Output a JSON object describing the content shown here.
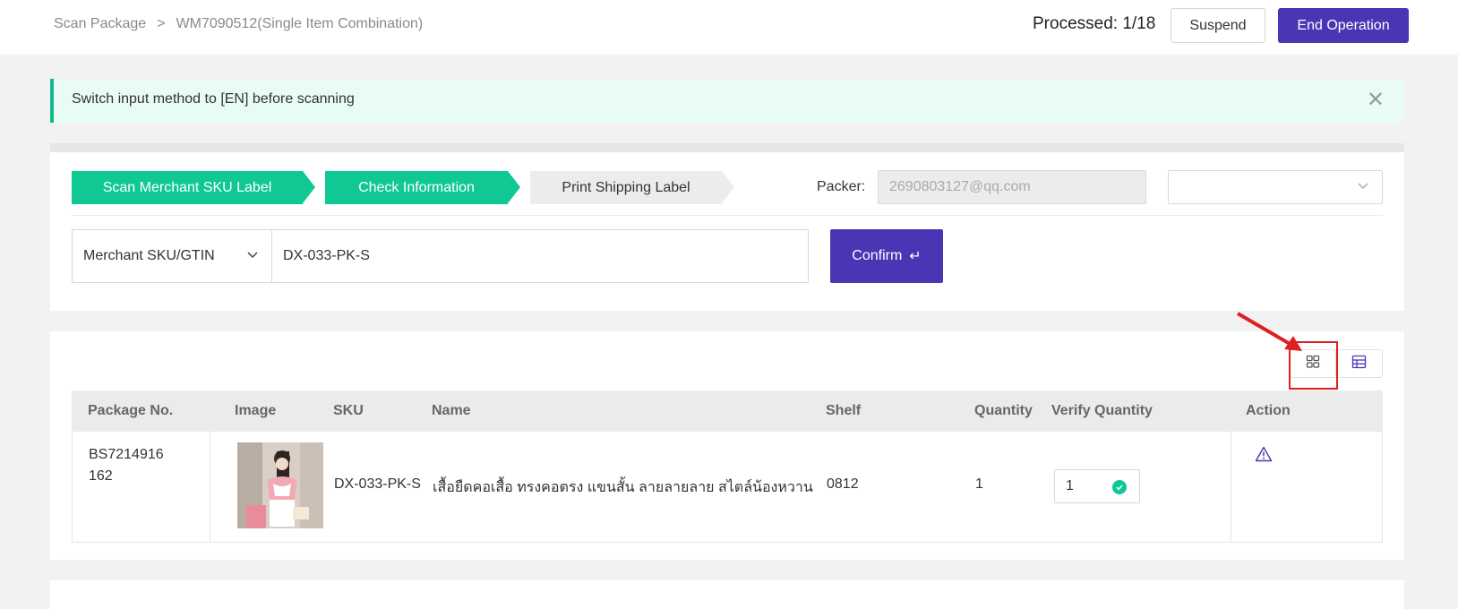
{
  "header": {
    "breadcrumb": [
      "Scan Package",
      ">",
      "WM7090512(Single Item Combination)"
    ],
    "processed": "Processed: 1/18",
    "suspend_label": "Suspend",
    "end_label": "End Operation"
  },
  "alert": {
    "text": "Switch input method to [EN] before scanning",
    "close": "✕"
  },
  "steps": [
    {
      "label": "Scan Merchant SKU Label",
      "state": "done"
    },
    {
      "label": "Check Information",
      "state": "active"
    },
    {
      "label": "Print Shipping Label",
      "state": "pending"
    }
  ],
  "packer": {
    "label": "Packer:",
    "value": "2690803127@qq.com",
    "select_value": ""
  },
  "scan": {
    "type": "Merchant SKU/GTIN",
    "value": "DX-033-PK-S",
    "confirm_label": "Confirm",
    "confirm_icon": "↵"
  },
  "table": {
    "headers": [
      "Package No.",
      "Image",
      "SKU",
      "Name",
      "Shelf",
      "Quantity",
      "Verify Quantity",
      "Action"
    ],
    "rows": [
      {
        "package_no_line1": "BS7214916",
        "package_no_line2": "162",
        "sku": "DX-033-PK-S",
        "name": "เสื้อยืดคอเสื้อ ทรงคอตรง แขนสั้น ลายลายลาย สไตล์น้องหวาน",
        "shelf": "0812",
        "quantity": "1",
        "verify_quantity": "1"
      }
    ]
  },
  "colors": {
    "accent": "#4a35b5",
    "step_active": "#0fc894",
    "highlight": "#e02020"
  }
}
